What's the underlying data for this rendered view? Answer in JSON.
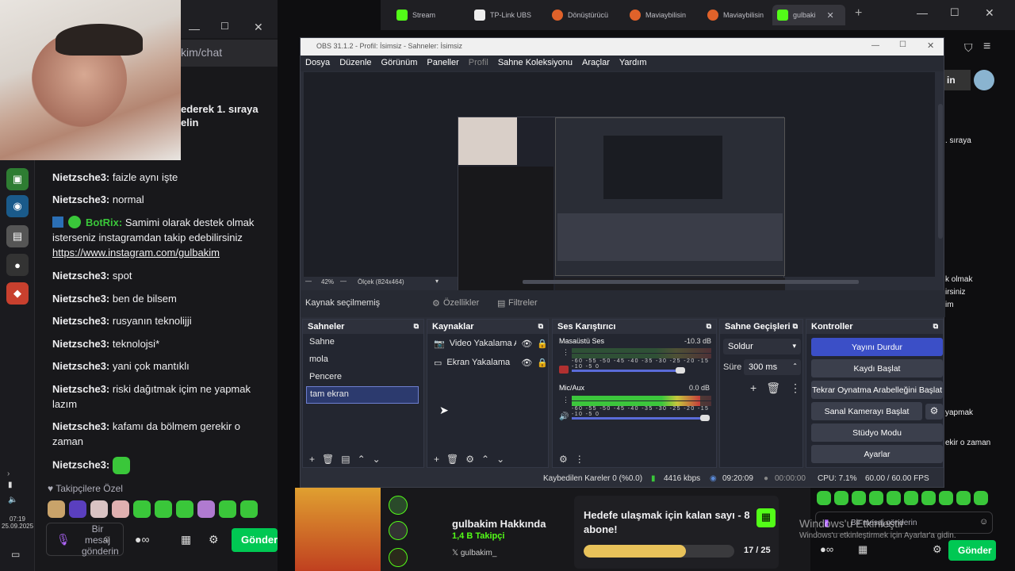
{
  "taskbar": {
    "clock": "07:19",
    "date": "25.09.2025"
  },
  "chat_top": {
    "url_fragment": "kim/chat",
    "first_place_text": "ederek 1. sıraya",
    "first_place_text2": "elin"
  },
  "chat_messages": [
    {
      "user": "Nietzsche3:",
      "text": "faizle aynı işte"
    },
    {
      "user": "Nietzsche3:",
      "text": "normal"
    },
    {
      "user": "BotRix:",
      "text": "Samimi olarak destek olmak isterseniz instagramdan takip edebilirsiniz",
      "link": "https://www.instagram.com/gulbakim"
    },
    {
      "user": "Nietzsche3:",
      "text": "spot"
    },
    {
      "user": "Nietzsche3:",
      "text": "ben de bilsem"
    },
    {
      "user": "Nietzsche3:",
      "text": "rusyanın teknolijji"
    },
    {
      "user": "Nietzsche3:",
      "text": "teknolojsi*"
    },
    {
      "user": "Nietzsche3:",
      "text": "yani çok mantıklı"
    },
    {
      "user": "Nietzsche3:",
      "text": "riski dağıtmak içim ne yapmak lazım"
    },
    {
      "user": "Nietzsche3:",
      "text": "kafamı da bölmem gerekir o zaman"
    },
    {
      "user": "Nietzsche3:",
      "text": ""
    }
  ],
  "chat_footer": {
    "followers_label": "Takipçilere Özel",
    "input_placeholder": "Bir mesaj gönderin",
    "send": "Gönder",
    "infinity": "∞"
  },
  "browser_tabs": [
    "Stream",
    "TP-Link UBS",
    "Dönüştürücü",
    "Maviaybilisin",
    "Maviaybilisin",
    "gulbaki"
  ],
  "obs": {
    "title": "OBS 31.1.2 - Profil: İsimsiz - Sahneler: İsimsiz",
    "menu": [
      "Dosya",
      "Düzenle",
      "Görünüm",
      "Paneller",
      "Profil",
      "Sahne Koleksiyonu",
      "Araçlar",
      "Yardım"
    ],
    "zoom": "42%",
    "scale": "Ölçek (824x464)",
    "source_bar": {
      "no_source": "Kaynak seçilmemiş",
      "properties": "Özellikler",
      "filters": "Filtreler"
    },
    "scenes": {
      "title": "Sahneler",
      "items": [
        "Sahne",
        "mola",
        "Pencere",
        "tam ekran"
      ]
    },
    "sources": {
      "title": "Kaynaklar",
      "items": [
        "Video Yakalama Ay",
        "Ekran Yakalama"
      ]
    },
    "mixer": {
      "title": "Ses Karıştırıcı",
      "ticks": "-60 -55 -50 -45 -40 -35 -30 -25 -20 -15 -10 -5 0",
      "channels": [
        {
          "name": "Masaüstü Ses",
          "db": "-10.3 dB",
          "muted": true,
          "volume": 0.82
        },
        {
          "name": "Mic/Aux",
          "db": "0.0 dB",
          "muted": false,
          "volume": 1.0,
          "level": 0.92
        }
      ]
    },
    "transitions": {
      "title": "Sahne Geçişleri",
      "type": "Soldur",
      "duration_label": "Süre",
      "duration": "300 ms"
    },
    "controls": {
      "title": "Kontroller",
      "buttons": [
        "Yayını Durdur",
        "Kaydı Başlat",
        "Tekrar Oynatma Arabelleğini Başlat",
        "Sanal Kamerayı Başlat",
        "Stüdyo Modu",
        "Ayarlar"
      ]
    },
    "status": {
      "dropped": "Kaybedilen Kareler 0 (%0.0)",
      "bitrate": "4416 kbps",
      "stream_time": "09:20:09",
      "rec_time": "00:00:00",
      "cpu": "CPU: 7.1%",
      "fps": "60.00 / 60.00 FPS"
    }
  },
  "stream_info": {
    "channel": "gulbakim Hakkında",
    "followers": "1,4 B Takipçi",
    "social": "gulbakim_",
    "goal": "Hedefe ulaşmak için kalan sayı - 8 abone!",
    "goal_count": "17 / 25",
    "goal_progress": 0.68
  },
  "right_panel": {
    "t1": ". sıraya",
    "t2": "k olmak",
    "t3": "irsiniz",
    "t4": "im",
    "t5": "yapmak",
    "t6": "ekir o zaman",
    "placeholder": "Bir mesaj gönderin",
    "send": "Gönder"
  },
  "windows": {
    "line1": "Windows'u Etkinleştir",
    "line2": "Windows'u etkinleştirmek için Ayarlar'a gidin."
  },
  "colors": {
    "accent_green": "#00f593",
    "obs_blue": "#3b4fc7",
    "twitch_bg": "#18181b"
  }
}
